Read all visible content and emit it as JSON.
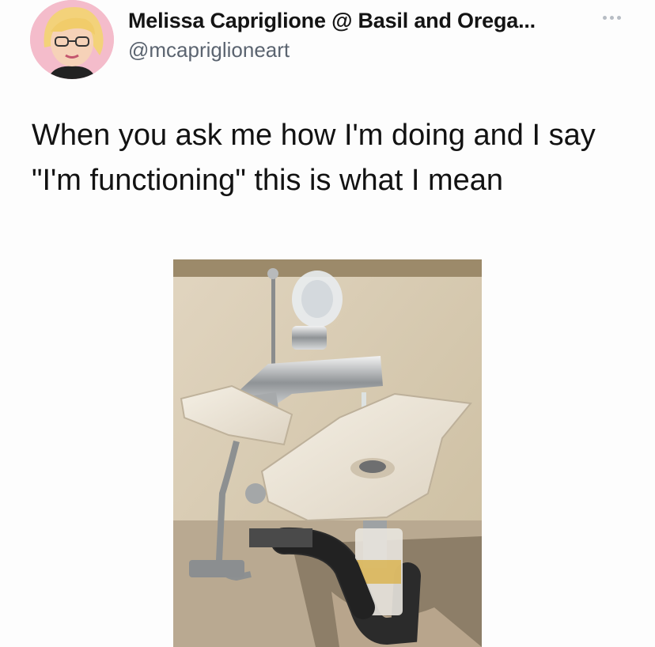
{
  "tweet": {
    "author": {
      "display_name": "Melissa Capriglione @ Basil and Orega...",
      "handle": "@mcapriglioneart",
      "avatar_icon": "avatar-illustration"
    },
    "more_icon": "ellipsis-icon",
    "text": "When you ask me how I'm doing and I say \"I'm functioning\" this is what I mean",
    "media": {
      "kind": "photo",
      "subject": "broken bathroom sink with running faucet"
    }
  },
  "colors": {
    "background": "#fdfdfd",
    "name": "#141414",
    "handle": "#5b6470",
    "text": "#121212"
  }
}
